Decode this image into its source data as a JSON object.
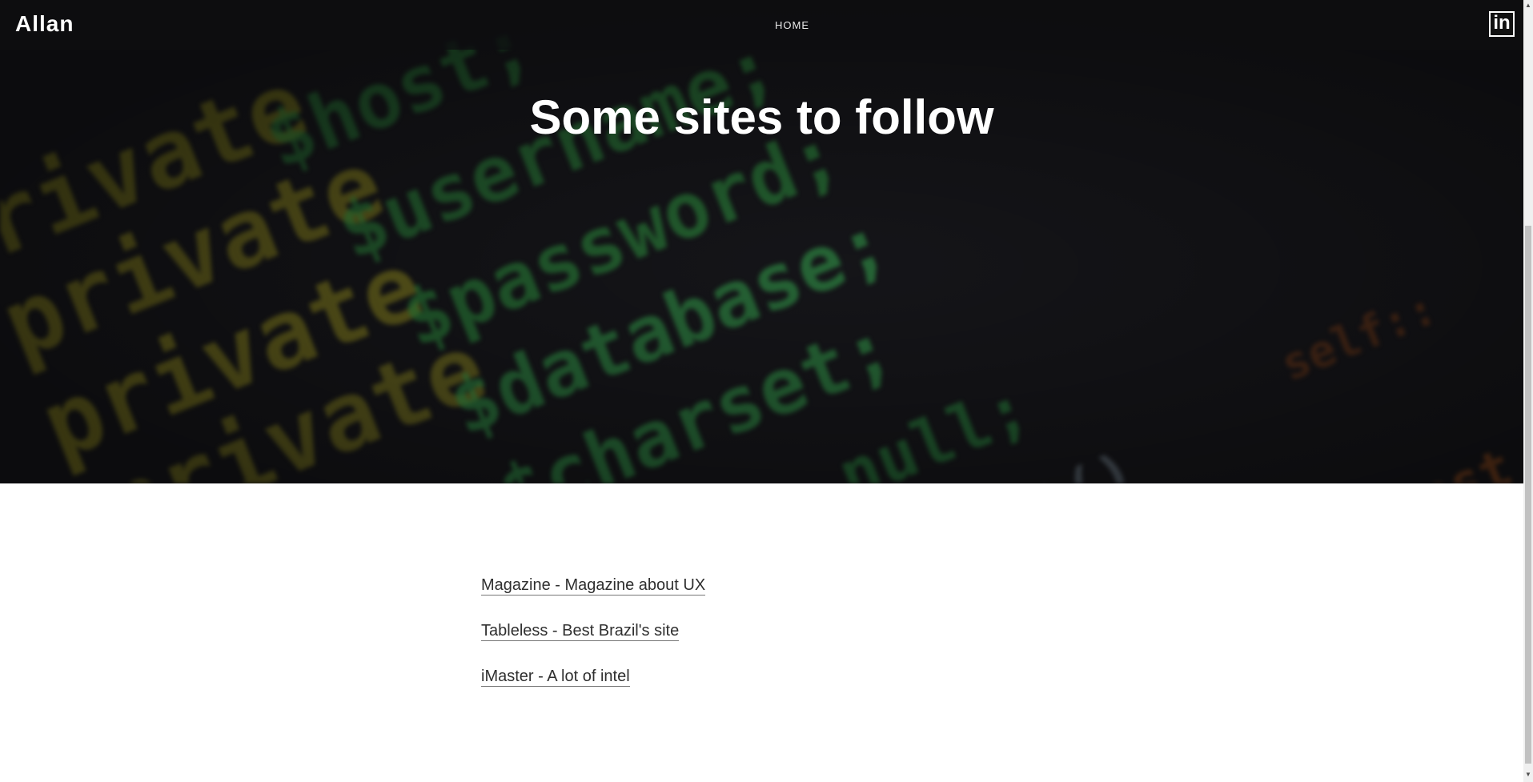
{
  "header": {
    "brand": "Allan",
    "nav": [
      "HOME"
    ],
    "linkedin_label": "in"
  },
  "hero": {
    "title": "Some sites to follow"
  },
  "links": [
    "Magazine - Magazine about UX",
    "Tableless - Best Brazil's site",
    "iMaster - A lot of intel"
  ],
  "scrollbar": {
    "up_arrow": "▲",
    "down_arrow": "▼"
  },
  "colors": {
    "hero_dark": "#16161a",
    "code_green": "#2f9a45",
    "code_yellow": "#b9b12a",
    "code_orange": "#c4611e",
    "code_blue": "#2b3f9e",
    "link_text": "#2f2f2f"
  }
}
